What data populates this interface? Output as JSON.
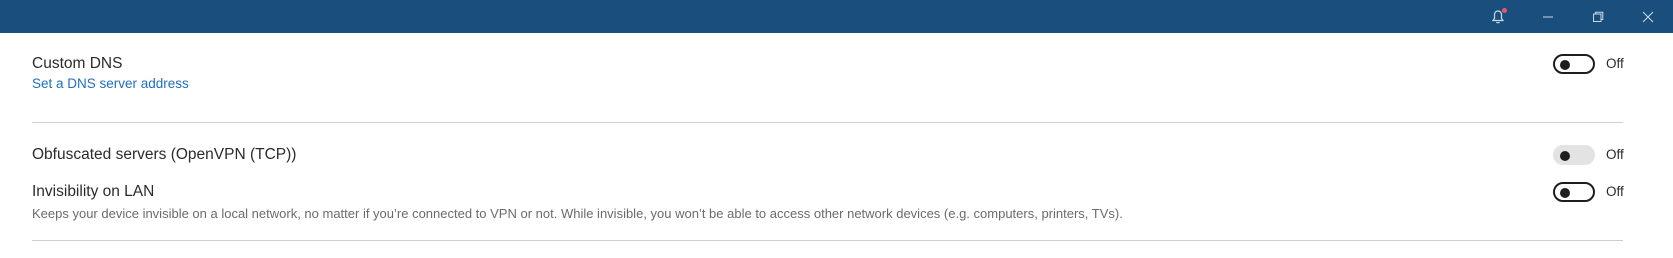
{
  "titlebar": {
    "color": "#1a4f7d",
    "icons": {
      "notification": "bell-icon",
      "minimize": "minimize-icon",
      "restore": "restore-icon",
      "close": "close-icon"
    }
  },
  "settings": [
    {
      "title": "Custom DNS",
      "link": "Set a DNS server address",
      "toggle_state": "off",
      "toggle_label": "Off"
    },
    {
      "title": "Obfuscated servers (OpenVPN (TCP))",
      "toggle_state": "off",
      "toggle_disabled": true,
      "toggle_label": "Off"
    },
    {
      "title": "Invisibility on LAN",
      "description": "Keeps your device invisible on a local network, no matter if you’re connected to VPN or not. While invisible, you won’t be able to access other network devices (e.g. computers, printers, TVs).",
      "toggle_state": "off",
      "toggle_label": "Off"
    }
  ],
  "colors": {
    "link": "#1f6fc2",
    "notification_dot": "#e7566a"
  }
}
